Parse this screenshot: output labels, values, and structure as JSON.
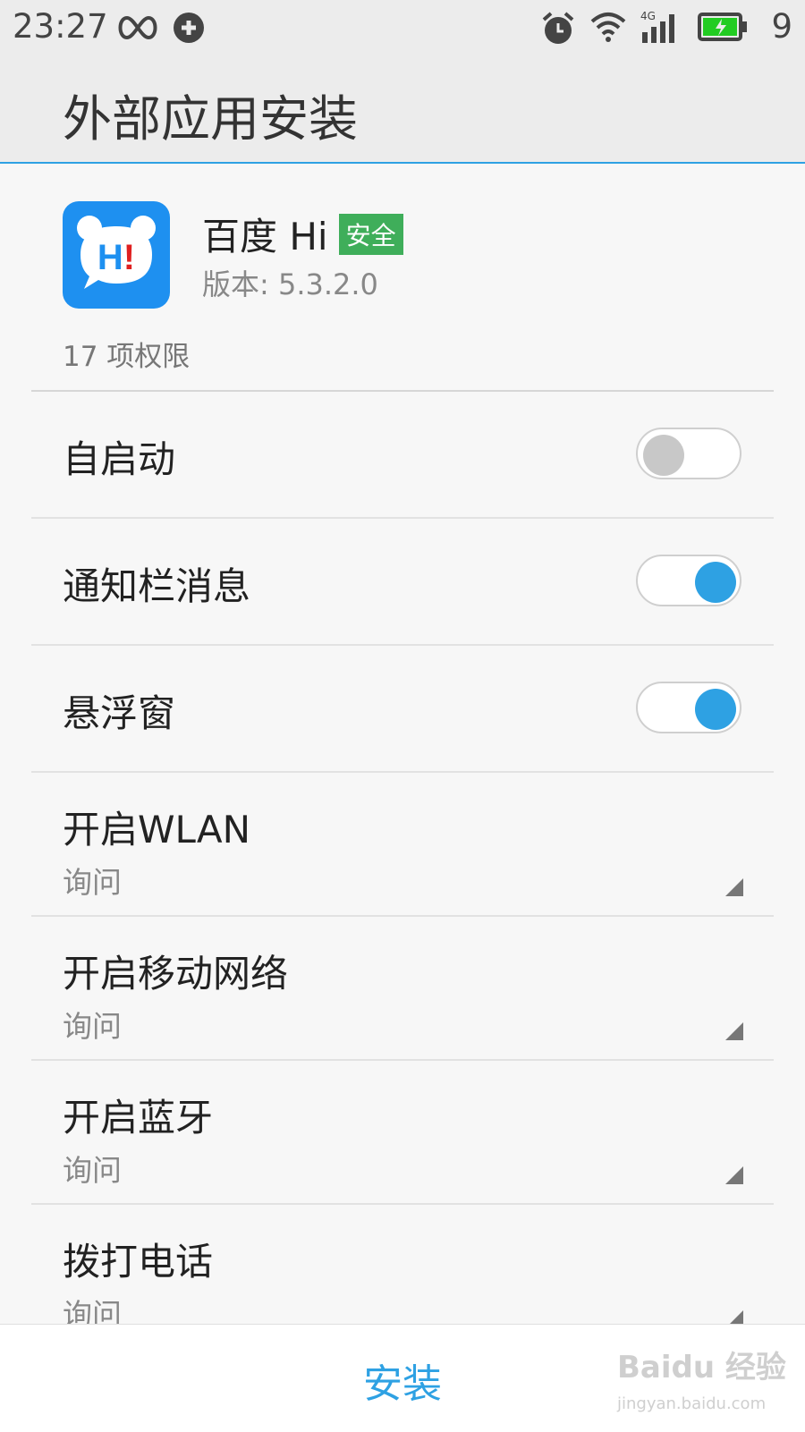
{
  "status_bar": {
    "time": "23:27",
    "battery_percent": "9",
    "icons": [
      "infinity-icon",
      "sync-icon",
      "alarm-icon",
      "wifi-icon",
      "signal-4g-icon",
      "battery-charging-icon"
    ]
  },
  "app_bar": {
    "title": "外部应用安装"
  },
  "app": {
    "name": "百度 Hi",
    "safety_badge": "安全",
    "version": "版本: 5.3.2.0",
    "icon_text": "H!",
    "icon_color": "#1e90f0"
  },
  "permissions": {
    "count_label": "17 项权限",
    "toggles": [
      {
        "label": "自启动",
        "enabled": false
      },
      {
        "label": "通知栏消息",
        "enabled": true
      },
      {
        "label": "悬浮窗",
        "enabled": true
      }
    ],
    "selects": [
      {
        "label": "开启WLAN",
        "value": "询问"
      },
      {
        "label": "开启移动网络",
        "value": "询问"
      },
      {
        "label": "开启蓝牙",
        "value": "询问"
      },
      {
        "label": "拨打电话",
        "value": "询问"
      }
    ]
  },
  "footer": {
    "install_label": "安装"
  },
  "watermark": {
    "logo": "Baidu 经验",
    "url": "jingyan.baidu.com"
  },
  "colors": {
    "accent": "#2ea1e3",
    "safe_badge": "#3fae5a",
    "toggle_off": "#c8c8c8"
  }
}
